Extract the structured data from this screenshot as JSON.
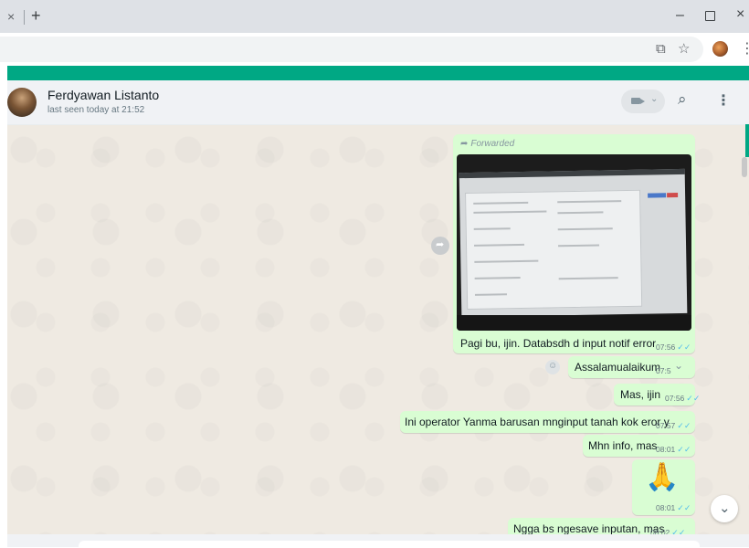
{
  "browser": {
    "new_tab_label": "+",
    "close_tab_glyph": "×",
    "minimize_glyph": "–",
    "close_window_glyph": "×"
  },
  "colors": {
    "accent_green": "#00a884",
    "outgoing_bubble": "#d9fdd3",
    "chat_background": "#efeae2",
    "read_tick": "#53bdeb"
  },
  "chat": {
    "contact_name": "Ferdyawan Listanto",
    "last_seen": "last seen today at 21:52",
    "messages": [
      {
        "type": "image",
        "forwarded_label": "Forwarded",
        "caption": "Pagi bu, ijin. Databsdh d input notif error",
        "time": "07:56",
        "status": "read"
      },
      {
        "type": "text",
        "text": "Assalamualaikum",
        "time": "07:5",
        "status": "read"
      },
      {
        "type": "text",
        "text": "Mas, ijin",
        "time": "07:56",
        "status": "read"
      },
      {
        "type": "text",
        "text": "Ini operator Yanma barusan mnginput tanah kok eror y",
        "time": "07:57",
        "status": "read"
      },
      {
        "type": "text",
        "text": "Mhn info, mas",
        "time": "08:01",
        "status": "read"
      },
      {
        "type": "emoji",
        "text": "🙏",
        "time": "08:01",
        "status": "read"
      },
      {
        "type": "text",
        "text": "Ngga bs ngesave inputan, mas",
        "time": "08:02",
        "status": "read"
      }
    ]
  },
  "icons": [
    "cast-icon",
    "star-icon",
    "profile-avatar",
    "video-call-icon",
    "search-icon",
    "menu-icon",
    "forward-icon",
    "emoji-icon",
    "chevron-down-icon"
  ]
}
